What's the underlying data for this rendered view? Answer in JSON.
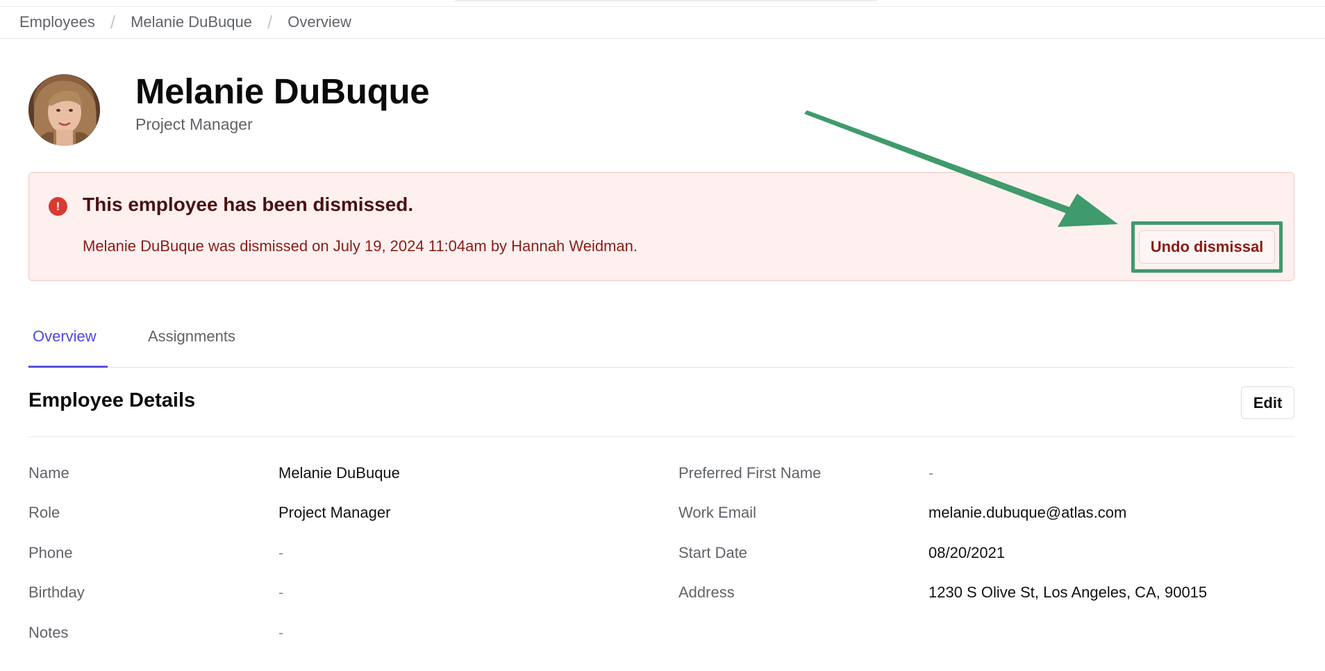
{
  "breadcrumb": [
    "Employees",
    "Melanie DuBuque",
    "Overview"
  ],
  "employee": {
    "name": "Melanie DuBuque",
    "title": "Project Manager"
  },
  "alert": {
    "icon": "alert-circle-icon",
    "icon_glyph": "!",
    "title": "This employee has been dismissed.",
    "body": "Melanie DuBuque was dismissed on July 19, 2024 11:04am by Hannah Weidman.",
    "button": "Undo dismissal"
  },
  "tabs": [
    "Overview",
    "Assignments"
  ],
  "active_tab": "Overview",
  "section": {
    "title": "Employee Details",
    "edit_label": "Edit"
  },
  "details_left": [
    {
      "label": "Name",
      "value": "Melanie DuBuque"
    },
    {
      "label": "Role",
      "value": "Project Manager"
    },
    {
      "label": "Phone",
      "value": "-"
    },
    {
      "label": "Birthday",
      "value": "-"
    },
    {
      "label": "Notes",
      "value": "-"
    }
  ],
  "details_right": [
    {
      "label": "Preferred First Name",
      "value": "-"
    },
    {
      "label": "Work Email",
      "value": "melanie.dubuque@atlas.com"
    },
    {
      "label": "Start Date",
      "value": "08/20/2021"
    },
    {
      "label": "Address",
      "value": "1230 S Olive St, Los Angeles, CA, 90015"
    }
  ],
  "colors": {
    "accent": "#4f46e5",
    "alert_bg": "#fdf0ef",
    "alert_text": "#8a1c16",
    "annotation": "#3f9a6c"
  }
}
